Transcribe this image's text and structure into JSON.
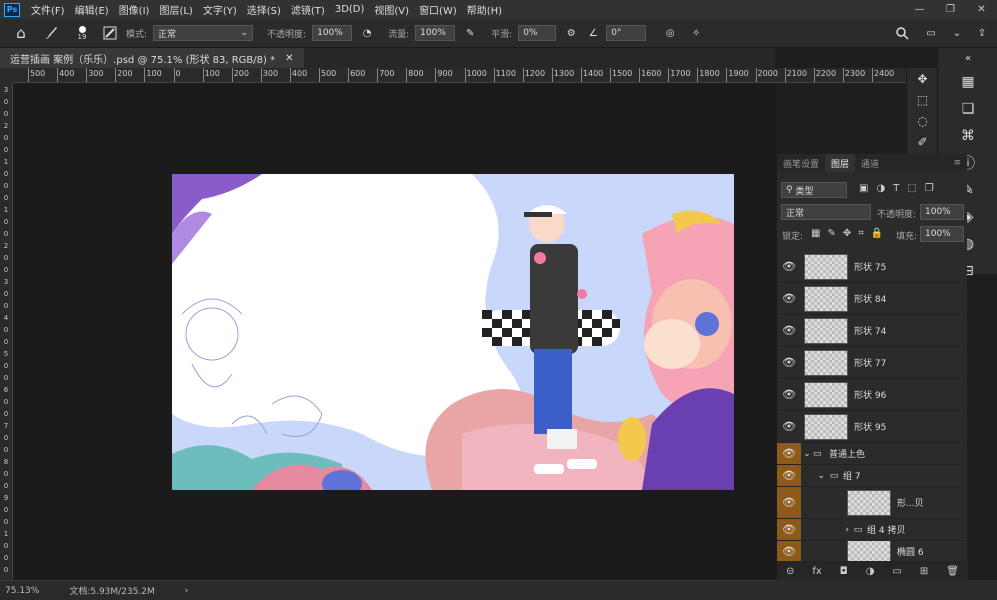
{
  "menubar": {
    "logo": "Ps",
    "items": [
      "文件(F)",
      "编辑(E)",
      "图像(I)",
      "图层(L)",
      "文字(Y)",
      "选择(S)",
      "滤镜(T)",
      "3D(D)",
      "视图(V)",
      "窗口(W)",
      "帮助(H)"
    ],
    "window": {
      "min": "—",
      "max": "❐",
      "close": "✕"
    }
  },
  "options": {
    "home_icon": "⌂",
    "brush_size": "19",
    "mode_label": "模式:",
    "mode_value": "正常",
    "opacity_label": "不透明度:",
    "opacity_value": "100%",
    "flow_label": "流量:",
    "flow_value": "100%",
    "smooth_label": "平滑:",
    "smooth_value": "0%",
    "angle_value": "0°"
  },
  "tab": {
    "title": "运营插画 案例（乐乐）.psd @ 75.1% (形状 83, RGB/8) *",
    "close": "✕"
  },
  "ruler": {
    "top_ticks": [
      "500",
      "400",
      "300",
      "200",
      "100",
      "0",
      "100",
      "200",
      "300",
      "400",
      "500",
      "600",
      "700",
      "800",
      "900",
      "1000",
      "1100",
      "1200",
      "1300",
      "1400",
      "1500",
      "1600",
      "1700",
      "1800",
      "1900",
      "2000",
      "2100",
      "2200",
      "2300",
      "2400"
    ],
    "left_ticks": [
      "3",
      "0",
      "0",
      "2",
      "0",
      "0",
      "1",
      "0",
      "0",
      "0",
      "1",
      "0",
      "0",
      "2",
      "0",
      "0",
      "3",
      "0",
      "0",
      "4",
      "0",
      "0",
      "5",
      "0",
      "0",
      "6",
      "0",
      "0",
      "7",
      "0",
      "0",
      "8",
      "0",
      "0",
      "9",
      "0",
      "0",
      "1",
      "0",
      "0",
      "0"
    ]
  },
  "status": {
    "zoom": "75.13%",
    "doc": "文档:5.93M/235.2M",
    "arrow": "›"
  },
  "layers": {
    "tabs": [
      "画笔设置",
      "图层",
      "通道"
    ],
    "active_tab": 1,
    "filter_kind": "类型",
    "blend": "正常",
    "opacity_label": "不透明度:",
    "opacity": "100%",
    "lock_label": "锁定:",
    "fill_label": "填充:",
    "fill": "100%",
    "items": [
      {
        "name": "形状 75",
        "type": "layer",
        "hl": false
      },
      {
        "name": "形状 84",
        "type": "layer",
        "hl": false
      },
      {
        "name": "形状 74",
        "type": "layer",
        "hl": false
      },
      {
        "name": "形状 77",
        "type": "layer",
        "hl": false
      },
      {
        "name": "形状 96",
        "type": "layer",
        "hl": false
      },
      {
        "name": "形状 95",
        "type": "layer",
        "hl": false
      },
      {
        "name": "普通上色",
        "type": "group",
        "hl": true
      },
      {
        "name": "组 7",
        "type": "group",
        "hl": true
      },
      {
        "name": "形...贝",
        "type": "layer",
        "hl": true
      },
      {
        "name": "组 4 拷贝",
        "type": "group",
        "hl": true
      },
      {
        "name": "椭圆 6",
        "type": "layer",
        "hl": true
      }
    ],
    "footer": [
      "⊝",
      "fx",
      "◘",
      "◑",
      "▭",
      "⊞",
      "🗑"
    ]
  },
  "colors": {
    "accent": "#31a8ff",
    "highlight": "#8d5b17",
    "bg": "#1e1e1e",
    "artboard": "#c9d7fb"
  }
}
